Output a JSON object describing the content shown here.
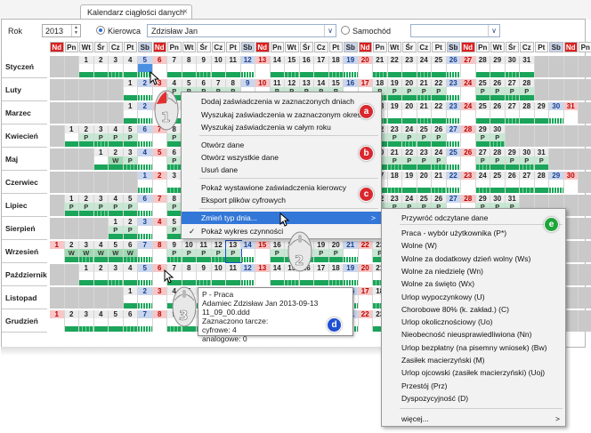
{
  "tab": {
    "title": "Kalendarz ciągłości danych",
    "close": "×"
  },
  "toolbar": {
    "rok_label": "Rok",
    "rok_value": "2013",
    "kierowca_label": "Kierowca",
    "kierowca_value": "Zdzisław Jan",
    "samochod_label": "Samochód",
    "samochod_value": "",
    "dropdown_glyph": "∨"
  },
  "day_headers": [
    "Nd",
    "Pn",
    "Wt",
    "Śr",
    "Cz",
    "Pt",
    "Sb",
    "Nd",
    "Pn",
    "Wt",
    "Śr",
    "Cz",
    "Pt",
    "Sb",
    "Nd",
    "Pn",
    "Wt",
    "Śr",
    "Cz",
    "Pt",
    "Sb",
    "Nd",
    "Pn",
    "Wt",
    "Śr",
    "Cz",
    "Pt",
    "Sb",
    "Nd",
    "Pn",
    "Wt",
    "Śr",
    "Cz",
    "Pt",
    "Sb",
    "Nd",
    "Pn"
  ],
  "months": [
    {
      "name": "Styczeń",
      "start": 2,
      "days": 31,
      "letters": {}
    },
    {
      "name": "Luty",
      "start": 5,
      "days": 28,
      "letters": {
        "4": "P",
        "5": "P",
        "6": "P",
        "7": "P",
        "8": "P",
        "11": "P",
        "12": "P",
        "13": "P",
        "14": "P",
        "15": "P",
        "18": "P",
        "19": "P",
        "20": "P",
        "21": "P",
        "22": "P",
        "25": "P",
        "26": "P",
        "27": "P",
        "28": "P"
      }
    },
    {
      "name": "Marzec",
      "start": 5,
      "days": 31,
      "letters": {}
    },
    {
      "name": "Kwiecień",
      "start": 1,
      "days": 30,
      "letters": {
        "2": "P",
        "3": "P",
        "4": "P",
        "5": "P",
        "8": "P",
        "9": "P",
        "10": "P",
        "11": "P",
        "12": "P",
        "15": "P",
        "16": "P",
        "17": "P",
        "18": "P",
        "19": "P",
        "22": "P",
        "23": "P",
        "24": "P",
        "25": "P",
        "26": "P",
        "29": "P",
        "30": "P"
      }
    },
    {
      "name": "Maj",
      "start": 3,
      "days": 31,
      "letters": {
        "2": "W",
        "3": "P",
        "6": "P",
        "7": "P",
        "8": "P",
        "9": "P",
        "10": "P",
        "13": "P",
        "14": "P",
        "15": "P",
        "16": "P",
        "17": "P",
        "20": "P",
        "21": "P",
        "22": "P",
        "23": "P",
        "24": "P",
        "27": "P",
        "28": "P",
        "29": "P",
        "30": "P",
        "31": "P"
      }
    },
    {
      "name": "Czerwiec",
      "start": 6,
      "days": 30,
      "letters": {}
    },
    {
      "name": "Lipiec",
      "start": 1,
      "days": 31,
      "letters": {
        "1": "P",
        "2": "P",
        "3": "P",
        "4": "P",
        "5": "P",
        "8": "P",
        "9": "P",
        "10": "P",
        "11": "P",
        "12": "P",
        "15": "P",
        "16": "P",
        "17": "P",
        "18": "P",
        "19": "P",
        "22": "P",
        "23": "P",
        "24": "P",
        "25": "P",
        "26": "P",
        "29": "P",
        "30": "P",
        "31": "P"
      }
    },
    {
      "name": "Sierpień",
      "start": 4,
      "days": 31,
      "letters": {
        "1": "P",
        "2": "P",
        "5": "P",
        "6": "P",
        "7": "P",
        "8": "P",
        "9": "P",
        "12": "P",
        "13": "P",
        "14": "P",
        "16": "P",
        "19": "P",
        "20": "P",
        "21": "P",
        "22": "P",
        "23": "P",
        "26": "P",
        "27": "P",
        "28": "P",
        "29": "P",
        "30": "P"
      }
    },
    {
      "name": "Wrzesień",
      "start": 0,
      "days": 30,
      "letters": {
        "2": "W",
        "3": "W",
        "4": "W",
        "5": "W",
        "6": "W",
        "9": "P",
        "10": "P",
        "11": "P",
        "12": "P",
        "13": "P",
        "16": "P",
        "17": "P",
        "18": "P",
        "19": "P",
        "20": "P",
        "23": "P",
        "24": "P",
        "25": "P",
        "26": "P",
        "27": "P",
        "30": "P"
      }
    },
    {
      "name": "Październik",
      "start": 2,
      "days": 31,
      "letters": {}
    },
    {
      "name": "Listopad",
      "start": 5,
      "days": 30,
      "letters": {}
    },
    {
      "name": "Grudzień",
      "start": 0,
      "days": 31,
      "letters": {}
    }
  ],
  "context_menu": {
    "items": [
      {
        "label": "Dodaj zaświadczenia w zaznaczonych dniach"
      },
      {
        "label": "Wyszukaj zaświadczenia w zaznaczonym okresie"
      },
      {
        "label": "Wyszukaj zaświadczenia w całym roku"
      },
      {
        "label": "Otwórz dane"
      },
      {
        "label": "Otwórz wszystkie dane"
      },
      {
        "label": "Usuń dane"
      },
      {
        "label": "Pokaż wystawione zaświadczenia kierowcy"
      },
      {
        "label": "Eksport plików cyfrowych"
      },
      {
        "label": "Zmień typ dnia..."
      },
      {
        "label": "Pokaż wykres czynności"
      }
    ],
    "check_glyph": "✓",
    "submenu_glyph": ">"
  },
  "submenu": {
    "items": [
      "Przywróć odczytane dane",
      "Praca - wybór użytkownika (P*)",
      "Wolne (W)",
      "Wolne za dodatkowy dzień wolny (Ws)",
      "Wolne za niedzielę (Wn)",
      "Wolne za święto (Wx)",
      "Urlop wypoczynkowy (U)",
      "Chorobowe 80% (k. zakład.) (C)",
      "Urlop okolicznościowy (Uo)",
      "Nieobecność nieusprawiedliwiona (Nn)",
      "Urlop bezpłatny (na pisemny wniosek) (Bw)",
      "Zasiłek macierzyński (M)",
      "Urlop ojcowski (zasiłek macierzyński) (Uoj)",
      "Przestój (Prz)",
      "Dyspozycyjność (D)",
      "więcej..."
    ],
    "submenu_glyph": ">"
  },
  "tooltip": {
    "lines": [
      "P - Praca",
      "Adamiec Zdzisław Jan 2013-09-13 11_09_00.ddd",
      "Zaznaczono tarcze:",
      "cyfrowe: 4",
      "analogowe: 0"
    ]
  },
  "badges": {
    "a": "a",
    "b": "b",
    "c": "c",
    "d": "d",
    "e": "e"
  },
  "steps": {
    "one": "1",
    "two": "2",
    "three": "3"
  },
  "colors": {
    "sunday": "#dd1f1f",
    "saturday": "#c7d3e8",
    "work_bar": "#1aa55a",
    "badge_red": "#d9272e",
    "badge_blue": "#1f4fd1",
    "badge_green": "#20a53b",
    "selection": "#3377d8"
  }
}
